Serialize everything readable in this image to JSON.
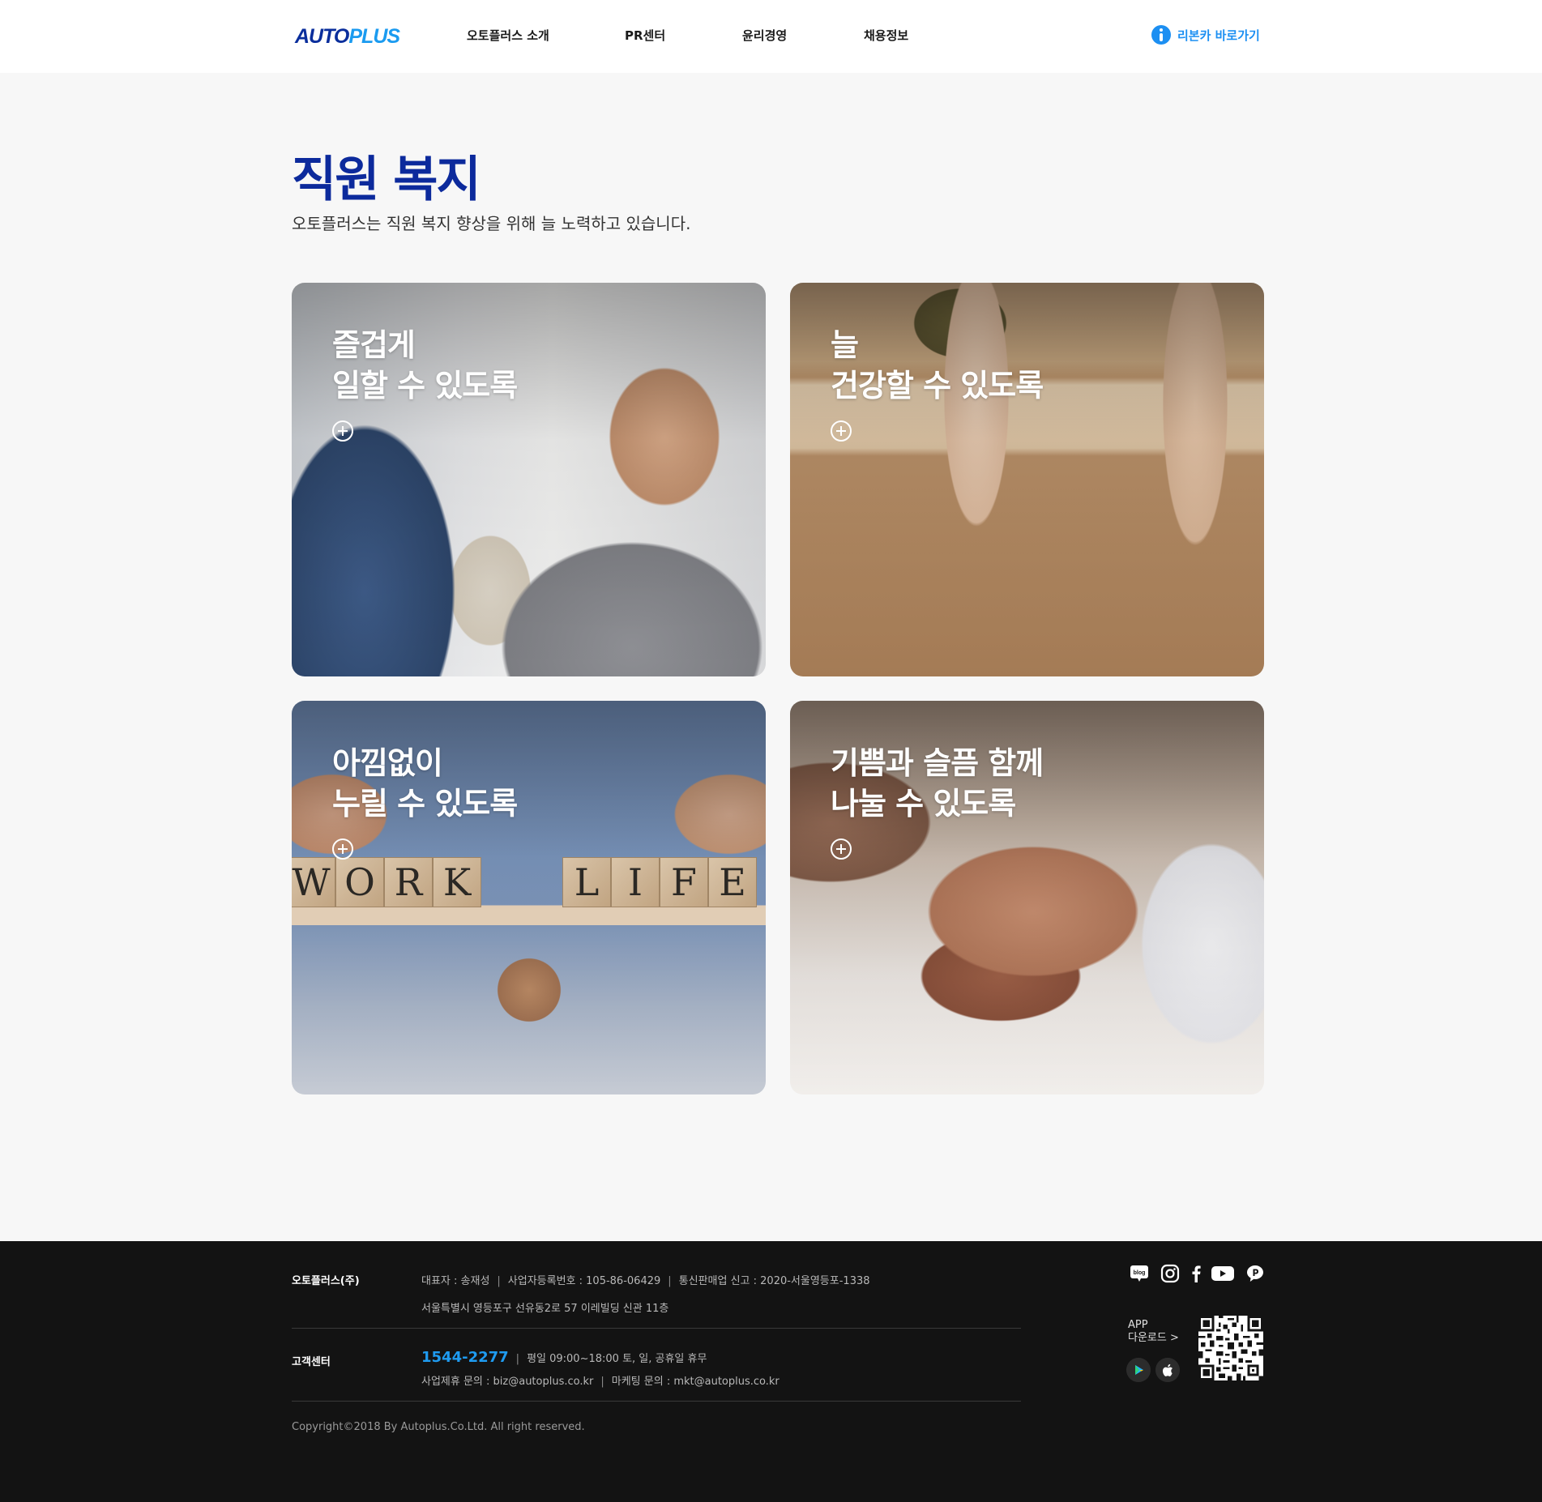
{
  "header": {
    "logo_part1": "AUTO",
    "logo_part2": "PLUS",
    "nav": [
      "오토플러스 소개",
      "PR센터",
      "윤리경영",
      "채용정보"
    ],
    "rental_link": "리본카 바로가기"
  },
  "main": {
    "title": "직원 복지",
    "subtitle": "오토플러스는 직원 복지 향상을 위해 늘 노력하고 있습니다.",
    "cards": [
      {
        "line1": "즐겁게",
        "line2": "일할 수 있도록"
      },
      {
        "line1": "늘",
        "line2": "건강할 수 있도록"
      },
      {
        "line1": "아낌없이",
        "line2": "누릴 수 있도록"
      },
      {
        "line1": "기쁨과 슬픔 함께",
        "line2": "나눌 수 있도록"
      }
    ],
    "work_blocks": [
      "W",
      "O",
      "R",
      "K"
    ],
    "life_blocks": [
      "L",
      "I",
      "F",
      "E"
    ]
  },
  "footer": {
    "company_label": "오토플러스(주)",
    "ceo": "대표자 : 송재성",
    "biz_no": "사업자등록번호 : 105-86-06429",
    "ecommerce": "통신판매업 신고 : 2020-서울영등포-1338",
    "address": "서울특별시 영등포구 선유동2로 57 이레빌딩 신관 11층",
    "cs_label": "고객센터",
    "phone": "1544-2277",
    "hours": "평일 09:00~18:00 토, 일, 공휴일 휴무",
    "biz_email": "사업제휴 문의 : biz@autoplus.co.kr",
    "mkt_email": "마케팅 문의 : mkt@autoplus.co.kr",
    "copyright": "Copyright©2018 By Autoplus.Co.Ltd. All right reserved.",
    "app_line1": "APP",
    "app_line2": "다운로드 >",
    "blog_label": "blog",
    "social_icons": [
      "blog-icon",
      "instagram-icon",
      "facebook-icon",
      "youtube-icon",
      "kakao-channel-icon"
    ],
    "store_icons": [
      "google-play-icon",
      "apple-icon"
    ]
  }
}
